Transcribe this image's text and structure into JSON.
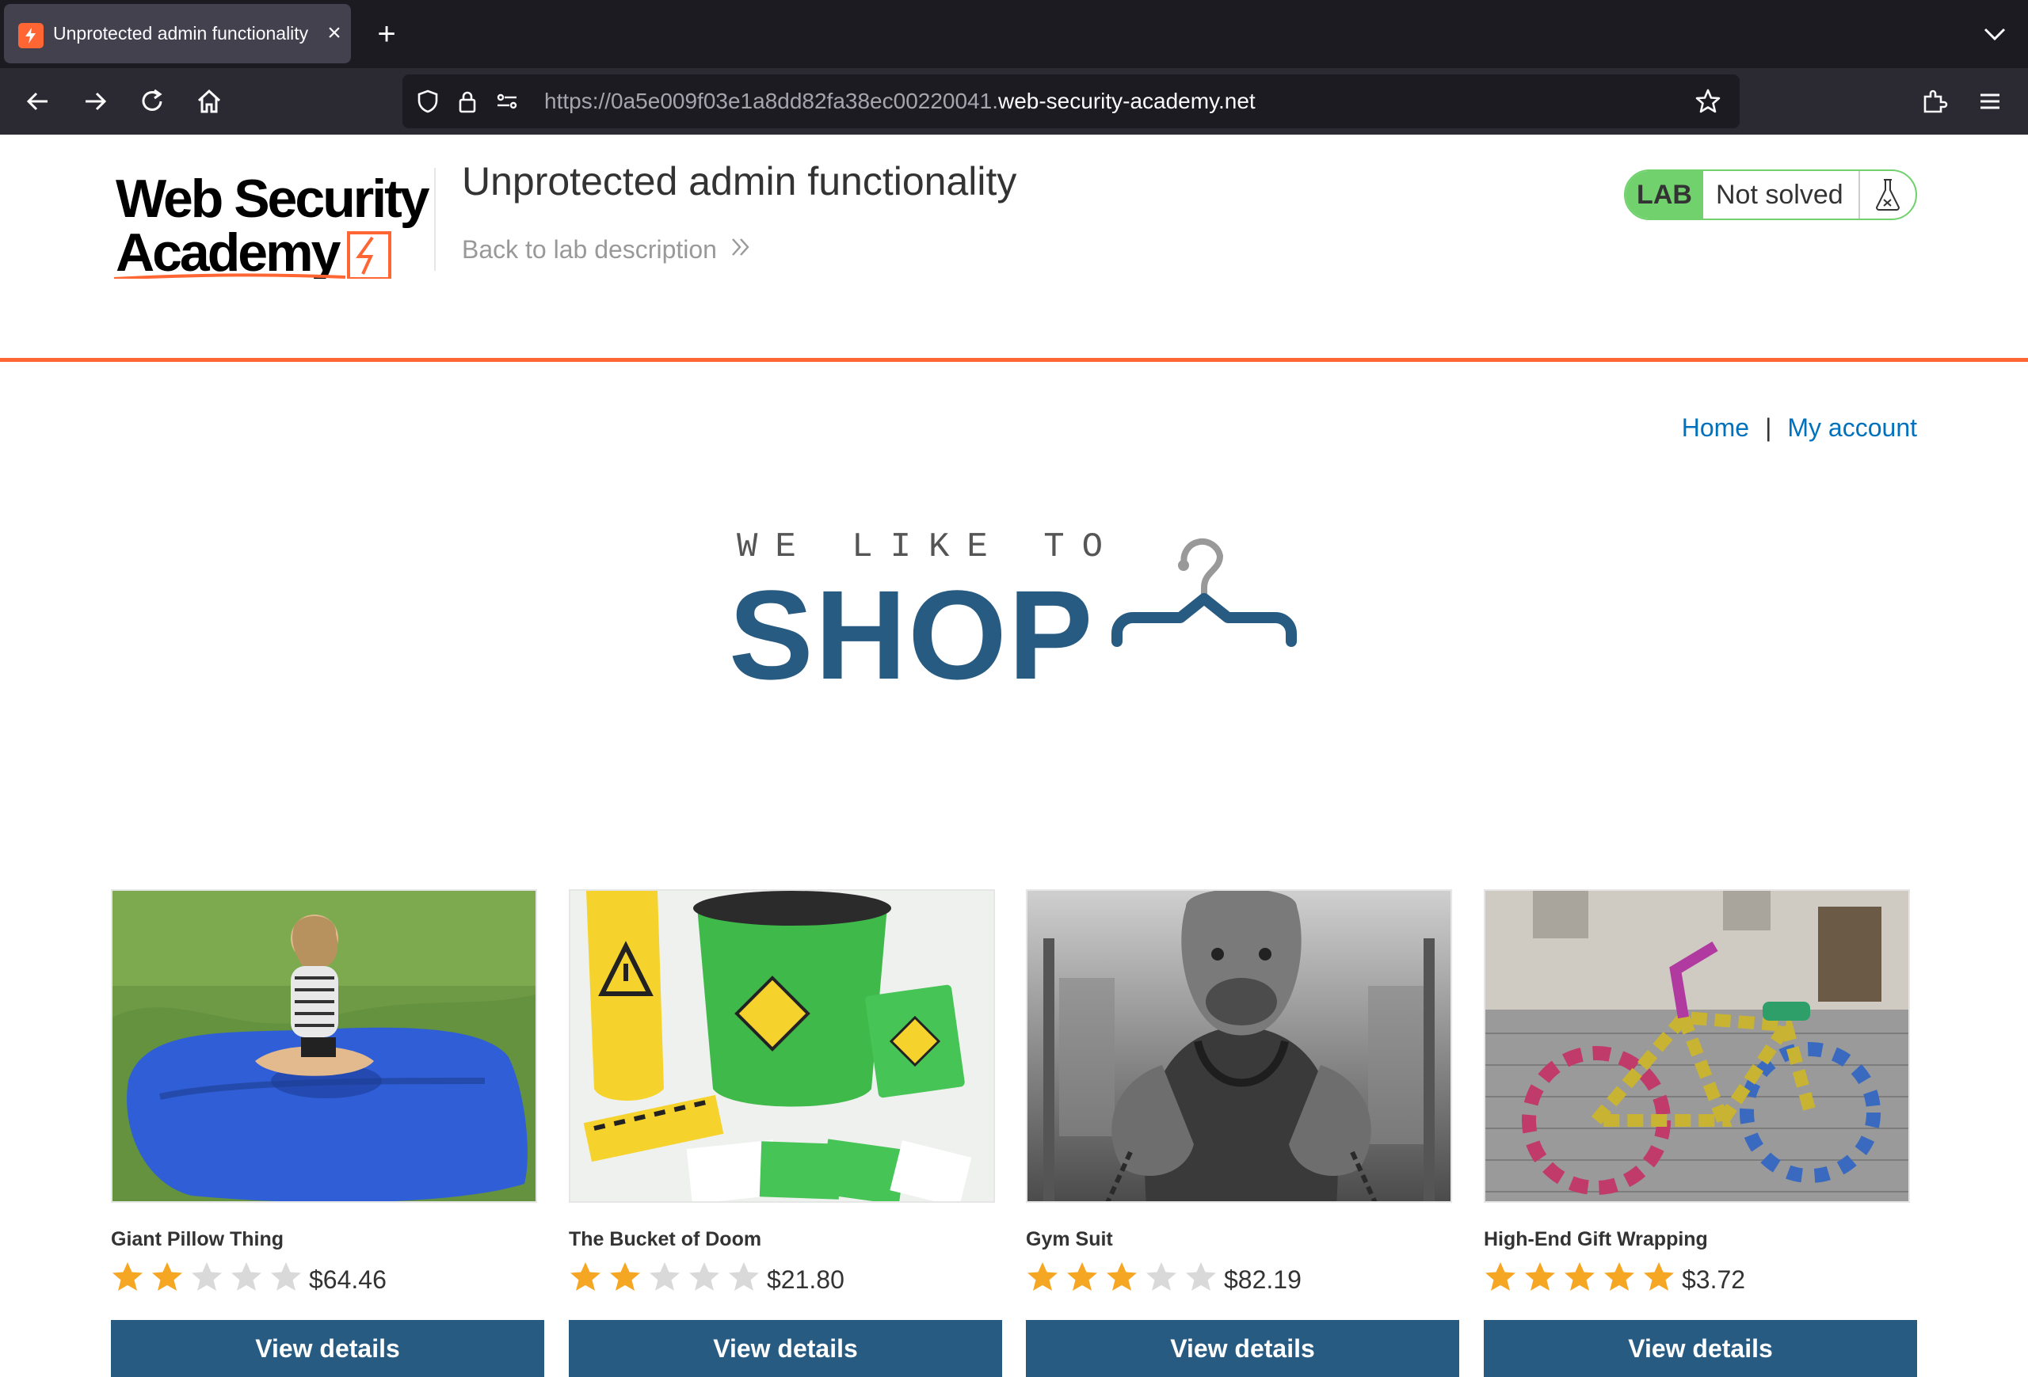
{
  "browser": {
    "tab_title": "Unprotected admin functionality",
    "url_prefix": "https://0a5e009f03e1a8dd82fa38ec00220041.",
    "url_domain": "web-security-academy.net"
  },
  "header": {
    "logo_line1": "Web Security",
    "logo_line2": "Academy",
    "lab_title": "Unprotected admin functionality",
    "back_link": "Back to lab description",
    "badge_lab": "LAB",
    "badge_status": "Not solved"
  },
  "nav": {
    "home": "Home",
    "separator": "|",
    "my_account": "My account"
  },
  "banner": {
    "small": "WE LIKE TO",
    "big": "SHOP"
  },
  "products": [
    {
      "name": "Giant Pillow Thing",
      "price": "$64.46",
      "rating": 2,
      "button": "View details"
    },
    {
      "name": "The Bucket of Doom",
      "price": "$21.80",
      "rating": 2,
      "button": "View details"
    },
    {
      "name": "Gym Suit",
      "price": "$82.19",
      "rating": 3,
      "button": "View details"
    },
    {
      "name": "High-End Gift Wrapping",
      "price": "$3.72",
      "rating": 5,
      "button": "View details"
    }
  ],
  "colors": {
    "brand_orange": "#ff6633",
    "button_blue": "#285b82",
    "link_blue": "#0071bc",
    "lab_green": "#70d16d",
    "star_gold": "#f5a623",
    "star_empty": "#d9d9d9"
  }
}
